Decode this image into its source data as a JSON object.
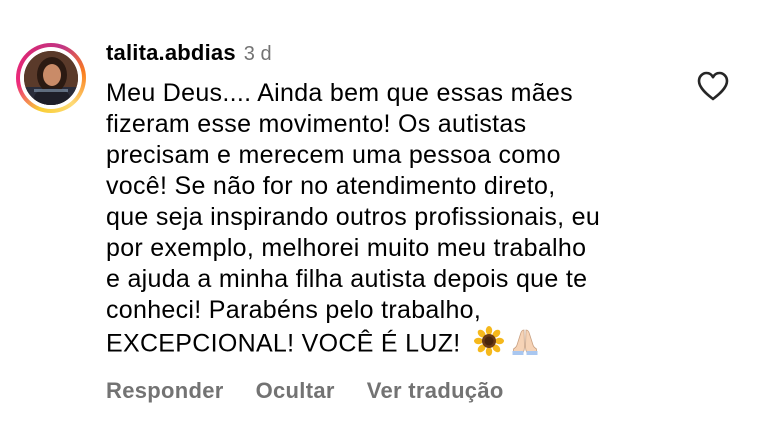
{
  "comment": {
    "username": "talita.abdias",
    "time_ago": "3 d",
    "text_lines": [
      "Meu Deus.... Ainda bem que essas mães",
      "fizeram esse movimento! Os autistas",
      "precisam e merecem uma pessoa como",
      "você! Se não for no atendimento direto,",
      "que seja inspirando outros profissionais, eu",
      "por exemplo, melhorei muito meu trabalho",
      "e ajuda a minha filha autista depois que te",
      "conheci! Parabéns pelo trabalho,",
      "EXCEPCIONAL! VOCÊ É LUZ!"
    ],
    "emojis": [
      "🌻",
      "🙏🏻"
    ],
    "icons": {
      "avatar": "profile-photo",
      "like": "heart-outline-icon",
      "emoji_1": "sunflower-emoji",
      "emoji_2": "folded-hands-emoji"
    }
  },
  "actions": {
    "reply": "Responder",
    "hide": "Ocultar",
    "translate": "Ver tradução"
  },
  "colors": {
    "text": "#000000",
    "secondary": "#737373",
    "background": "#ffffff"
  }
}
